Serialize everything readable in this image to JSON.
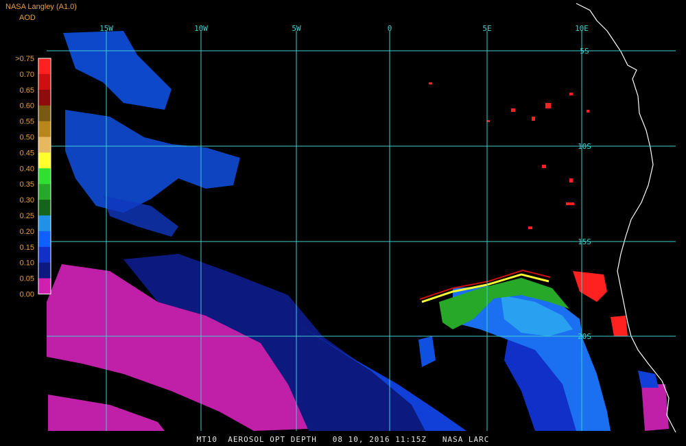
{
  "header": {
    "title": "NASA Langley (A1.0)",
    "product": "AOD"
  },
  "legend": {
    "labels": [
      ">0.75",
      "0.70",
      "0.65",
      "0.60",
      "0.55",
      "0.50",
      "0.45",
      "0.40",
      "0.35",
      "0.30",
      "0.25",
      "0.20",
      "0.15",
      "0.10",
      "0.05",
      "0.00"
    ],
    "colors": [
      "#ff2020",
      "#cc1010",
      "#8e0c0c",
      "#7a5a10",
      "#b9861c",
      "#e8b860",
      "#ffff30",
      "#30e030",
      "#28a828",
      "#14641c",
      "#2090e8",
      "#1060ff",
      "#1030c8",
      "#0c1a80",
      "#d020b0"
    ]
  },
  "map": {
    "longitude_labels": [
      "15W",
      "10W",
      "5W",
      "0",
      "5E",
      "10E"
    ],
    "latitude_labels": [
      "5S",
      "10S",
      "15S",
      "20S"
    ],
    "grid_color": "#40d0d0"
  },
  "caption": "MT10  AEROSOL OPT DEPTH   08 10, 2016 11:15Z   NASA LARC"
}
